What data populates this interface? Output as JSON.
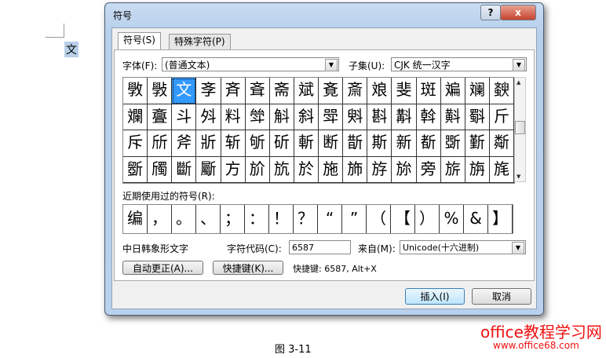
{
  "document": {
    "selected_char": "文",
    "caption": "图 3-11"
  },
  "dialog": {
    "title": "符号",
    "help_label": "?",
    "close_label": "x",
    "tabs": [
      {
        "label": "符号(S)"
      },
      {
        "label": "特殊字符(P)"
      }
    ],
    "font_label": "字体(F):",
    "font_value": "(普通文本)",
    "subset_label": "子集(U):",
    "subset_value": "CJK 统一汉字",
    "grid": [
      [
        "斆",
        "斅",
        "文",
        "斈",
        "斉",
        "斊",
        "斋",
        "斌",
        "斍",
        "斎",
        "斏",
        "斐",
        "斑",
        "斒",
        "斓",
        "斔"
      ],
      [
        "斕",
        "斖",
        "斗",
        "斘",
        "料",
        "斚",
        "斛",
        "斜",
        "斝",
        "斞",
        "斟",
        "斠",
        "斡",
        "斢",
        "斣",
        "斤"
      ],
      [
        "斥",
        "斦",
        "斧",
        "斨",
        "斩",
        "斪",
        "斫",
        "斬",
        "断",
        "斮",
        "斯",
        "新",
        "斱",
        "斲",
        "斳",
        "斴"
      ],
      [
        "斵",
        "斶",
        "斷",
        "斸",
        "方",
        "斺",
        "斻",
        "於",
        "施",
        "斾",
        "斿",
        "旀",
        "旁",
        "旂",
        "旃",
        "旄"
      ]
    ],
    "selected_cell": "文",
    "recent_label": "近期使用过的符号(R):",
    "recent": [
      "编",
      "，",
      "。",
      "、",
      "；",
      "：",
      "！",
      "？",
      "“",
      "”",
      "（",
      "【",
      "）",
      "%",
      "&",
      "】"
    ],
    "char_name": "中日韩象形文字",
    "code_label": "字符代码(C):",
    "code_value": "6587",
    "from_label": "来自(M):",
    "from_value": "Unicode(十六进制)",
    "autocorrect_label": "自动更正(A)...",
    "shortcut_key_label": "快捷键(K)...",
    "shortcut_info": "快捷键: 6587, Alt+X",
    "insert_label": "插入(I)",
    "cancel_label": "取消"
  },
  "watermark": {
    "line1": "office教程学习网",
    "line2": "www.office68.com"
  }
}
